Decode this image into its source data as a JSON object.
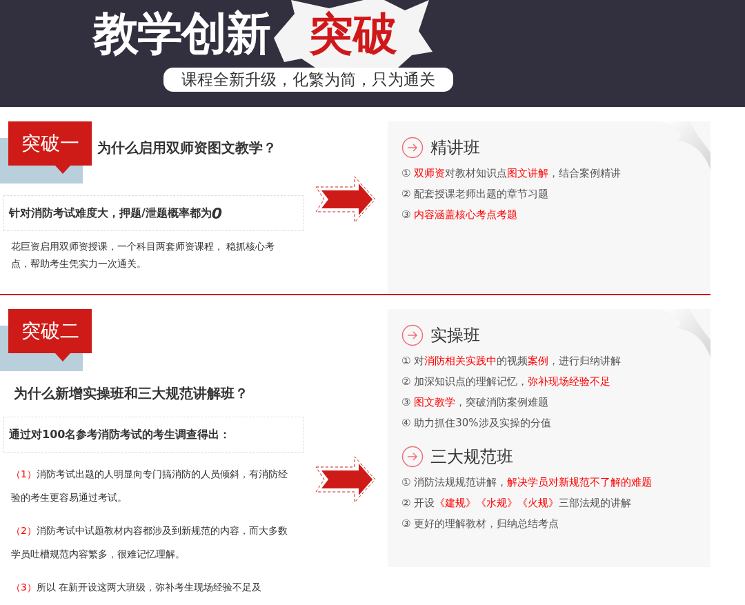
{
  "header": {
    "title": "教学创新",
    "highlight": "突破",
    "subtitle": "课程全新升级，化繁为简，只为通关"
  },
  "sections": [
    {
      "kind": "compact",
      "badge": "突破一",
      "title": "为什么启用双师资图文教学？",
      "callout": [
        {
          "text": "针对消防考试难度大，押题/泄题概率都为",
          "big": false
        },
        {
          "text": "0",
          "big": true
        }
      ],
      "paragraphs": [
        [
          {
            "text": "花巨资启用双师资授课，一个科目两套师资课程， 稳抓核心考点，帮助考生凭实力一次通关。",
            "red": false
          }
        ]
      ],
      "panel": [
        {
          "heading": "精讲班",
          "items": [
            [
              {
                "text": "① ",
                "red": false
              },
              {
                "text": "双师资",
                "red": true
              },
              {
                "text": "对教材知识点",
                "red": false
              },
              {
                "text": "图文讲解",
                "red": true
              },
              {
                "text": "，结合案例精讲",
                "red": false
              }
            ],
            [
              {
                "text": "② 配套授课老师出题的章节习题",
                "red": false
              }
            ],
            [
              {
                "text": "③ ",
                "red": false
              },
              {
                "text": "内容涵盖核心考点考题",
                "red": true
              }
            ]
          ]
        }
      ]
    },
    {
      "kind": "stacked",
      "badge": "突破二",
      "title": "为什么新增实操班和三大规范讲解班？",
      "callout": [
        {
          "text": "通过对100名参考消防考试的考生调查得出：",
          "big": false
        }
      ],
      "paragraphs": [
        [
          {
            "text": "（1）",
            "red": true
          },
          {
            "text": "消防考试出题的人明显向专门搞消防的人员倾斜，有消防经验的考生更容易通过考试。",
            "red": false
          }
        ],
        [
          {
            "text": "（2）",
            "red": true
          },
          {
            "text": "消防考试中试题教材内容都涉及到新规范的内容，而大多数学员吐槽规范内容繁多，很难记忆理解。",
            "red": false
          }
        ],
        [
          {
            "text": "（3）",
            "red": true
          },
          {
            "text": "所以 在新开设这两大班级，弥补考生现场经验不足及",
            "red": false
          }
        ]
      ],
      "panel": [
        {
          "heading": "实操班",
          "items": [
            [
              {
                "text": "① 对",
                "red": false
              },
              {
                "text": "消防相关实践中",
                "red": true
              },
              {
                "text": "的视频",
                "red": false
              },
              {
                "text": "案例",
                "red": true
              },
              {
                "text": "，进行归纳讲解",
                "red": false
              }
            ],
            [
              {
                "text": "② 加深知识点的理解记忆，",
                "red": false
              },
              {
                "text": "弥补现场经验不足",
                "red": true
              }
            ],
            [
              {
                "text": "③ ",
                "red": false
              },
              {
                "text": "图文教学",
                "red": true
              },
              {
                "text": "，突破消防案例难题",
                "red": false
              }
            ],
            [
              {
                "text": "④ 助力抓住30%涉及实操的分值",
                "red": false
              }
            ]
          ]
        },
        {
          "heading": "三大规范班",
          "items": [
            [
              {
                "text": "① 消防法规规范讲解，",
                "red": false
              },
              {
                "text": "解决学员对新规范不了解的难题",
                "red": true
              }
            ],
            [
              {
                "text": "② 开设",
                "red": false
              },
              {
                "text": "《建规》《水规》《火规》",
                "red": true
              },
              {
                "text": "三部法规的讲解",
                "red": false
              }
            ],
            [
              {
                "text": "③ 更好的理解教材，归纳总结考点",
                "red": false
              }
            ]
          ]
        }
      ]
    }
  ]
}
